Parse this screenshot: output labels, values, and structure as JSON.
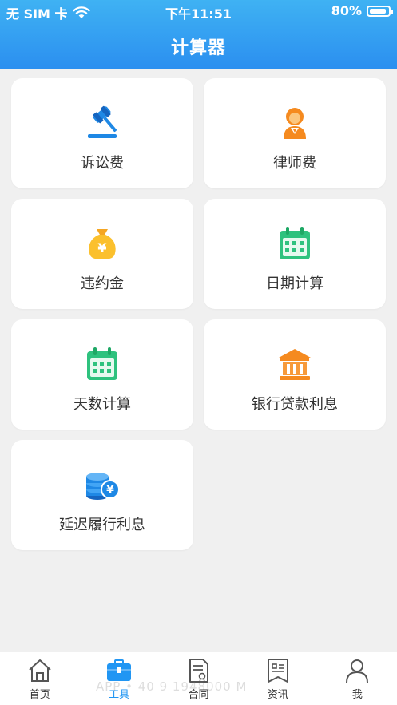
{
  "status": {
    "carrier": "无 SIM 卡",
    "time": "下午11:51",
    "battery": "80%"
  },
  "header": {
    "title": "计算器"
  },
  "cards": [
    {
      "label": "诉讼费",
      "icon": "gavel-icon"
    },
    {
      "label": "律师费",
      "icon": "lawyer-icon"
    },
    {
      "label": "违约金",
      "icon": "money-bag-icon"
    },
    {
      "label": "日期计算",
      "icon": "calendar-icon"
    },
    {
      "label": "天数计算",
      "icon": "calendar-icon"
    },
    {
      "label": "银行贷款利息",
      "icon": "bank-icon"
    },
    {
      "label": "延迟履行利息",
      "icon": "coins-icon"
    }
  ],
  "tabs": [
    {
      "label": "首页",
      "icon": "home-icon"
    },
    {
      "label": "工具",
      "icon": "toolbox-icon",
      "active": true
    },
    {
      "label": "合同",
      "icon": "contract-icon"
    },
    {
      "label": "资讯",
      "icon": "news-icon"
    },
    {
      "label": "我",
      "icon": "user-icon"
    }
  ],
  "watermark": "APP • 40  9  1948000  M",
  "colors": {
    "header": "#2b8ff0",
    "active_tab": "#2196f3",
    "gold": "#f5a623",
    "green": "#2ec27e",
    "blue": "#1e88e5"
  }
}
